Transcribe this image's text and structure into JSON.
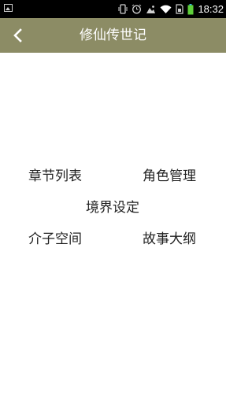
{
  "status_bar": {
    "time": "18:32",
    "icons": [
      "image-notification-icon",
      "vibrate-icon",
      "alarm-icon",
      "photo-icon",
      "wifi-icon",
      "sim-icon",
      "battery-icon"
    ]
  },
  "app_bar": {
    "title": "修仙传世记",
    "back_icon": "chevron-left-icon",
    "background_color": "#8c8c65"
  },
  "menu": {
    "chapter_list": "章节列表",
    "character_management": "角色管理",
    "realm_settings": "境界设定",
    "mustard_space": "介子空间",
    "story_outline": "故事大纲"
  }
}
